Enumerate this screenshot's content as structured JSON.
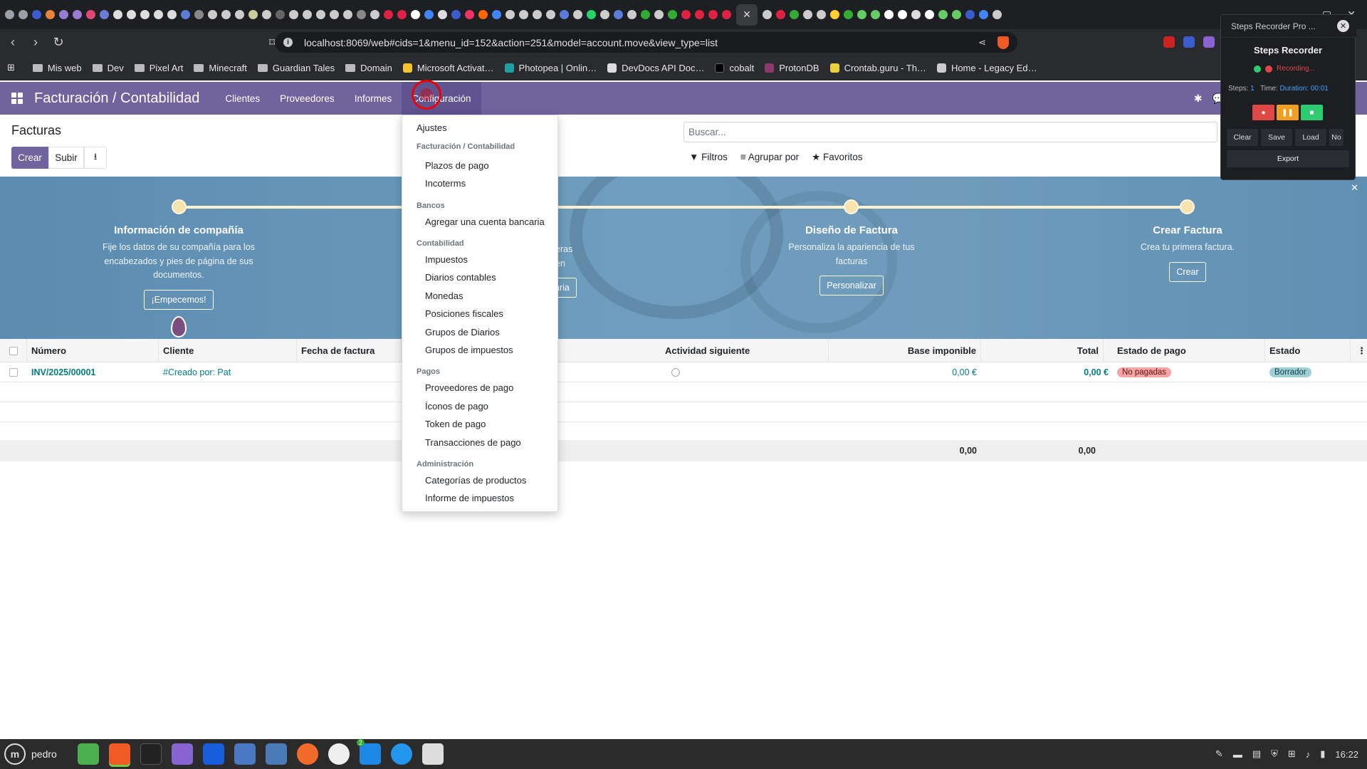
{
  "browser": {
    "url": "localhost:8069/web#cids=1&menu_id=152&action=251&model=account.move&view_type=list",
    "bookmarks": [
      "Mis web",
      "Dev",
      "Pixel Art",
      "Minecraft",
      "Guardian Tales",
      "Domain",
      "Microsoft Activat…",
      "Photopea | Onlin…",
      "DevDocs API Doc…",
      "cobalt",
      "ProtonDB",
      "Crontab.guru - Th…",
      "Home - Legacy Ed…"
    ]
  },
  "app": {
    "title": "Facturación / Contabilidad",
    "menu": [
      "Clientes",
      "Proveedores",
      "Informes",
      "Configuración"
    ]
  },
  "control": {
    "breadcrumb": "Facturas",
    "create": "Crear",
    "upload": "Subir",
    "search_placeholder": "Buscar...",
    "filters": "Filtros",
    "group_by": "Agrupar por",
    "favorites": "Favoritos"
  },
  "banner": {
    "steps": [
      {
        "title": "Información de compañía",
        "text": "Fije los datos de su compañía para los encabezados y pies de página de sus documentos.",
        "button": "¡Empecemos!"
      },
      {
        "title": "",
        "text": "eras en",
        "button": "aria"
      },
      {
        "title": "Diseño de Factura",
        "text": "Personaliza la apariencia de tus facturas",
        "button": "Personalizar"
      },
      {
        "title": "Crear Factura",
        "text": "Crea tu primera factura.",
        "button": "Crear"
      }
    ]
  },
  "table": {
    "headers": [
      "Número",
      "Cliente",
      "Fecha de factura",
      "Actividad siguiente",
      "Base imponible",
      "Total",
      "Estado de pago",
      "Estado"
    ],
    "rows": [
      {
        "number": "INV/2025/00001",
        "client": "#Creado por: Pat",
        "base": "0,00 €",
        "total": "0,00 €",
        "payment": "No pagadas",
        "state": "Borrador"
      }
    ],
    "footer": {
      "base": "0,00",
      "total": "0,00"
    }
  },
  "dropdown": {
    "top": "Ajustes",
    "sections": [
      {
        "head": "Facturación / Contabilidad",
        "items": [
          "Plazos de pago",
          "Incoterms"
        ]
      },
      {
        "head": "Bancos",
        "items": [
          "Agregar una cuenta bancaria"
        ]
      },
      {
        "head": "Contabilidad",
        "items": [
          "Impuestos",
          "Diarios contables",
          "Monedas",
          "Posiciones fiscales",
          "Grupos de Diarios",
          "Grupos de impuestos"
        ]
      },
      {
        "head": "Pagos",
        "items": [
          "Proveedores de pago",
          "Íconos de pago",
          "Token de pago",
          "Transacciones de pago"
        ]
      },
      {
        "head": "Administración",
        "items": [
          "Categorías de productos",
          "Informe de impuestos"
        ]
      }
    ]
  },
  "recorder": {
    "tab": "Steps Recorder Pro ...",
    "title": "Steps Recorder",
    "status": "Recording...",
    "steps_label": "Steps:",
    "steps": "1",
    "time_label": "Time:",
    "duration": "Duration: 00:01",
    "actions": [
      "Clear",
      "Save",
      "Load",
      "No"
    ],
    "export": "Export"
  },
  "taskbar": {
    "user": "pedro",
    "time": "16:22",
    "badge": "2"
  }
}
